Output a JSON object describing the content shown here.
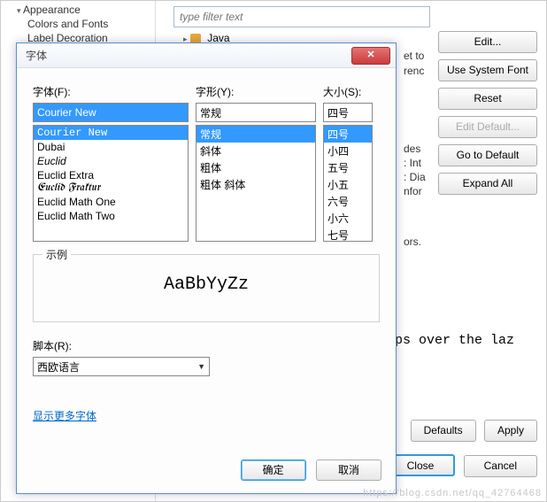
{
  "bg": {
    "tree": {
      "appearance": "Appearance",
      "colors_fonts": "Colors and Fonts",
      "label_decoration": "Label Decoration"
    },
    "filter_placeholder": "type filter text",
    "java": "Java",
    "buttons": {
      "edit": "Edit...",
      "use_system_font": "Use System Font",
      "reset": "Reset",
      "edit_default": "Edit Default...",
      "go_to_default": "Go to Default",
      "expand_all": "Expand All",
      "defaults": "Defaults",
      "apply": "Apply",
      "close": "Close",
      "cancel": "Cancel"
    },
    "snips": {
      "et_to": "et to",
      "renc": "renc",
      "des": "des",
      "int": ": Int",
      "dia": ": Dia",
      "nfor": "nfor",
      "ors": "ors.",
      "preview": "ps over the laz"
    }
  },
  "dialog": {
    "title": "字体",
    "font_label": "字体(F):",
    "style_label": "字形(Y):",
    "size_label": "大小(S):",
    "font_value": "Courier New",
    "style_value": "常规",
    "size_value": "四号",
    "fonts": [
      "Courier New",
      "Dubai",
      "Euclid",
      "Euclid Extra",
      "Euclid Fraktur",
      "Euclid Math One",
      "Euclid Math Two"
    ],
    "styles": [
      "常规",
      "斜体",
      "粗体",
      "粗体 斜体"
    ],
    "sizes": [
      "四号",
      "小四",
      "五号",
      "小五",
      "六号",
      "小六",
      "七号"
    ],
    "sample_label": "示例",
    "sample_text": "AaBbYyZz",
    "script_label": "脚本(R):",
    "script_value": "西欧语言",
    "more_fonts": "显示更多字体",
    "ok": "确定",
    "cancel": "取消"
  },
  "watermark": "https://blog.csdn.net/qq_42764468"
}
